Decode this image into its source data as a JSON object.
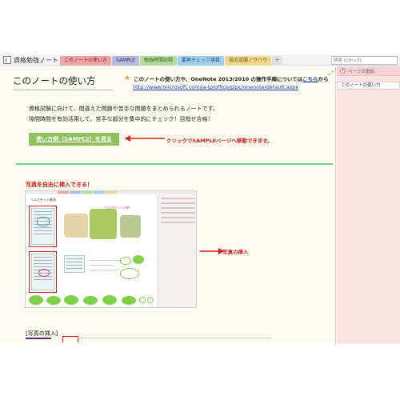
{
  "notebook": {
    "name": "資格勉強ノート"
  },
  "tabs": [
    {
      "label": "このノートの使い方"
    },
    {
      "label": "SAMPLE"
    },
    {
      "label": "勉強時間記録"
    },
    {
      "label": "要再チェック項目"
    },
    {
      "label": "弱点克服ノウハウ"
    },
    {
      "label": "+"
    }
  ],
  "search": {
    "placeholder": "検索 (Ctrl+E)"
  },
  "page": {
    "title": "このノートの使い方",
    "intro_text": "このノートの使い方や、OneNote 2013/2010 の操作手順については",
    "intro_link": "こちら",
    "intro_tail": "から",
    "intro_url": "http://www.microsoft.com/ja-jp/office/pipc/onenote/default.aspx",
    "desc_line1": "資格試験に向けて、間違えた問題や苦手な問題をまとめられるノートです。",
    "desc_line2": "隙間時間を有効活用して、苦手な部分を集中的にチェック！目指せ合格！",
    "sample_button": "使い方例（SAMPLE）を見る",
    "note_click": "クリックでSAMPLEページへ移動できます。",
    "photo_title": "写真を自由に挿入できる！",
    "note_insert": "写真の挿入",
    "section_label": "[写真の挿入]",
    "embedded": {
      "title": "ベルガモット精油",
      "pink_text": "ベルガモットの果"
    }
  },
  "sidebar": {
    "add_page": "ページの追加",
    "pages": [
      {
        "label": "このノートの使い方"
      }
    ]
  },
  "colors": {
    "accent_green": "#8dc25a",
    "annotation_red": "#e01a1a",
    "link_blue": "#1a3ec0"
  }
}
